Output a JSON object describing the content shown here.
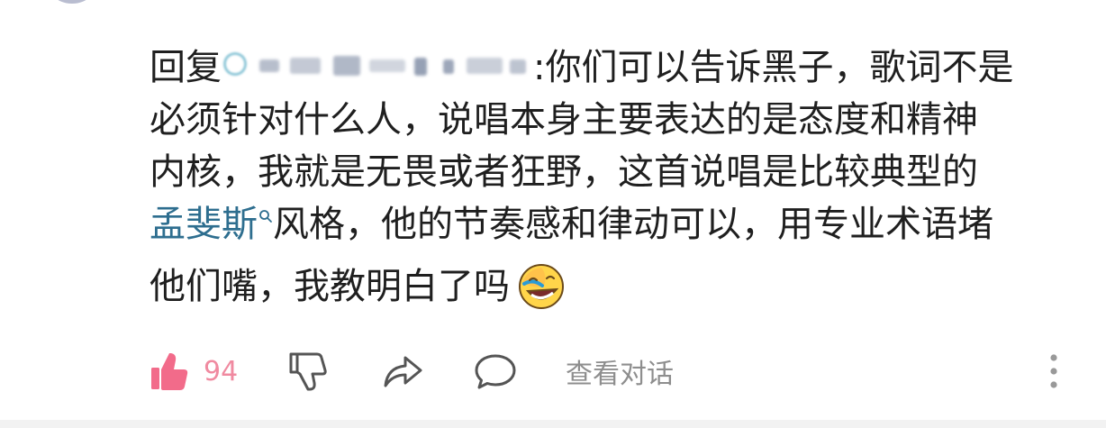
{
  "comment": {
    "reply_prefix": "回复",
    "username_censored": true,
    "line1_rest": ":你们可以告诉黑子，歌词不是",
    "line2": "必须针对什么人，说唱本身主要表达的是态度和精神",
    "line3": "内核，我就是无畏或者狂野，这首说唱是比较典型的",
    "topic_link": "孟斐斯",
    "line4_rest": "风格，他的节奏感和律动可以，用专业术语堵",
    "line5": "他们嘴，我教明白了吗",
    "emoji": "laughing-face-emoji"
  },
  "actions": {
    "like_count": "94",
    "view_conversation_label": "查看对话"
  },
  "icons": {
    "like": "thumbs-up-icon",
    "dislike": "thumbs-down-icon",
    "share": "share-arrow-icon",
    "reply": "comment-bubble-icon",
    "more": "more-vertical-icon",
    "topic_search": "search-icon"
  },
  "colors": {
    "like_accent": "#f08aa0",
    "link": "#2e6e8f",
    "muted": "#8e8e8e",
    "text": "#1f1f1f"
  }
}
